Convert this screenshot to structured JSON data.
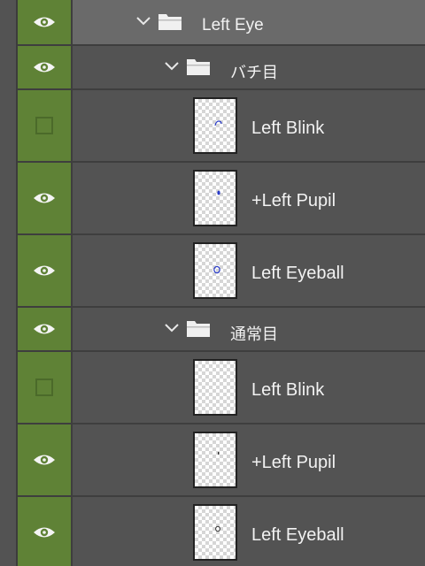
{
  "layers": [
    {
      "kind": "group",
      "name": "Left Eye",
      "visible": true,
      "selected": true,
      "expanded": true,
      "icons": [
        "eye-icon",
        "chevron-down-icon",
        "folder-icon"
      ]
    },
    {
      "kind": "group",
      "name": "バチ目",
      "visible": true,
      "selected": false,
      "expanded": true,
      "icons": [
        "eye-icon",
        "chevron-down-icon",
        "folder-icon"
      ]
    },
    {
      "kind": "layer",
      "name": "Left Blink",
      "visible": false,
      "thumbnail": "small-blue-curve"
    },
    {
      "kind": "layer",
      "name": "+Left Pupil",
      "visible": true,
      "thumbnail": "small-blue-dot"
    },
    {
      "kind": "layer",
      "name": "Left Eyeball",
      "visible": true,
      "thumbnail": "small-blue-circle"
    },
    {
      "kind": "group",
      "name": "通常目",
      "visible": true,
      "selected": false,
      "expanded": true,
      "icons": [
        "eye-icon",
        "chevron-down-icon",
        "folder-icon"
      ]
    },
    {
      "kind": "layer",
      "name": "Left Blink",
      "visible": false,
      "thumbnail": "empty"
    },
    {
      "kind": "layer",
      "name": "+Left Pupil",
      "visible": true,
      "thumbnail": "tiny-dark-dot"
    },
    {
      "kind": "layer",
      "name": "Left Eyeball",
      "visible": true,
      "thumbnail": "tiny-dark-circle"
    }
  ],
  "colors": {
    "panel_bg": "#535353",
    "selected_row_bg": "#6a6a6a",
    "visibility_column": "#5f8236",
    "text": "#f2f2f2"
  }
}
